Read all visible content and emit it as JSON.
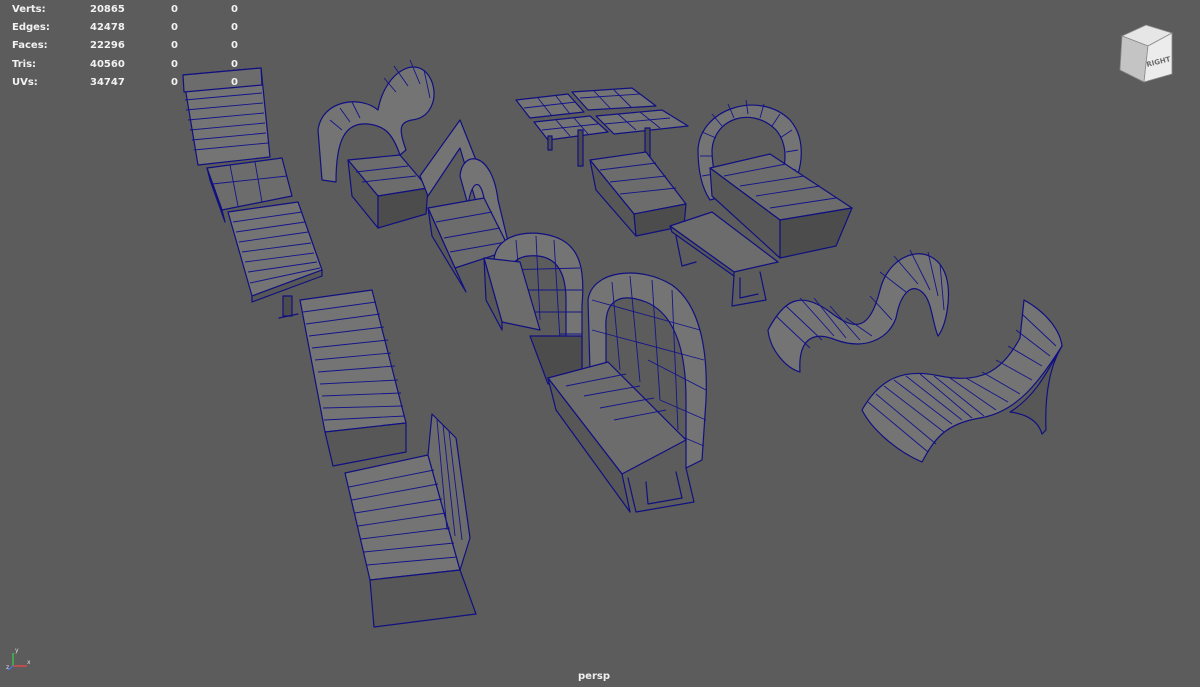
{
  "hud": {
    "rows": [
      {
        "label": "Verts:",
        "total": "20865",
        "selected": "0",
        "components": "0"
      },
      {
        "label": "Edges:",
        "total": "42478",
        "selected": "0",
        "components": "0"
      },
      {
        "label": "Faces:",
        "total": "22296",
        "selected": "0",
        "components": "0"
      },
      {
        "label": "Tris:",
        "total": "40560",
        "selected": "0",
        "components": "0"
      },
      {
        "label": "UVs:",
        "total": "34747",
        "selected": "0",
        "components": "0"
      }
    ]
  },
  "view_cube": {
    "face_label": "RIGHT"
  },
  "camera": {
    "label": "persp"
  },
  "axis_gizmo": {
    "x": "x",
    "y": "y",
    "z": "z"
  },
  "colors": {
    "viewport_background": "#5c5c5c",
    "wireframe": "#101080",
    "shaded_surface": "#6c6c6c",
    "hud_text": "#f2f2f2"
  }
}
